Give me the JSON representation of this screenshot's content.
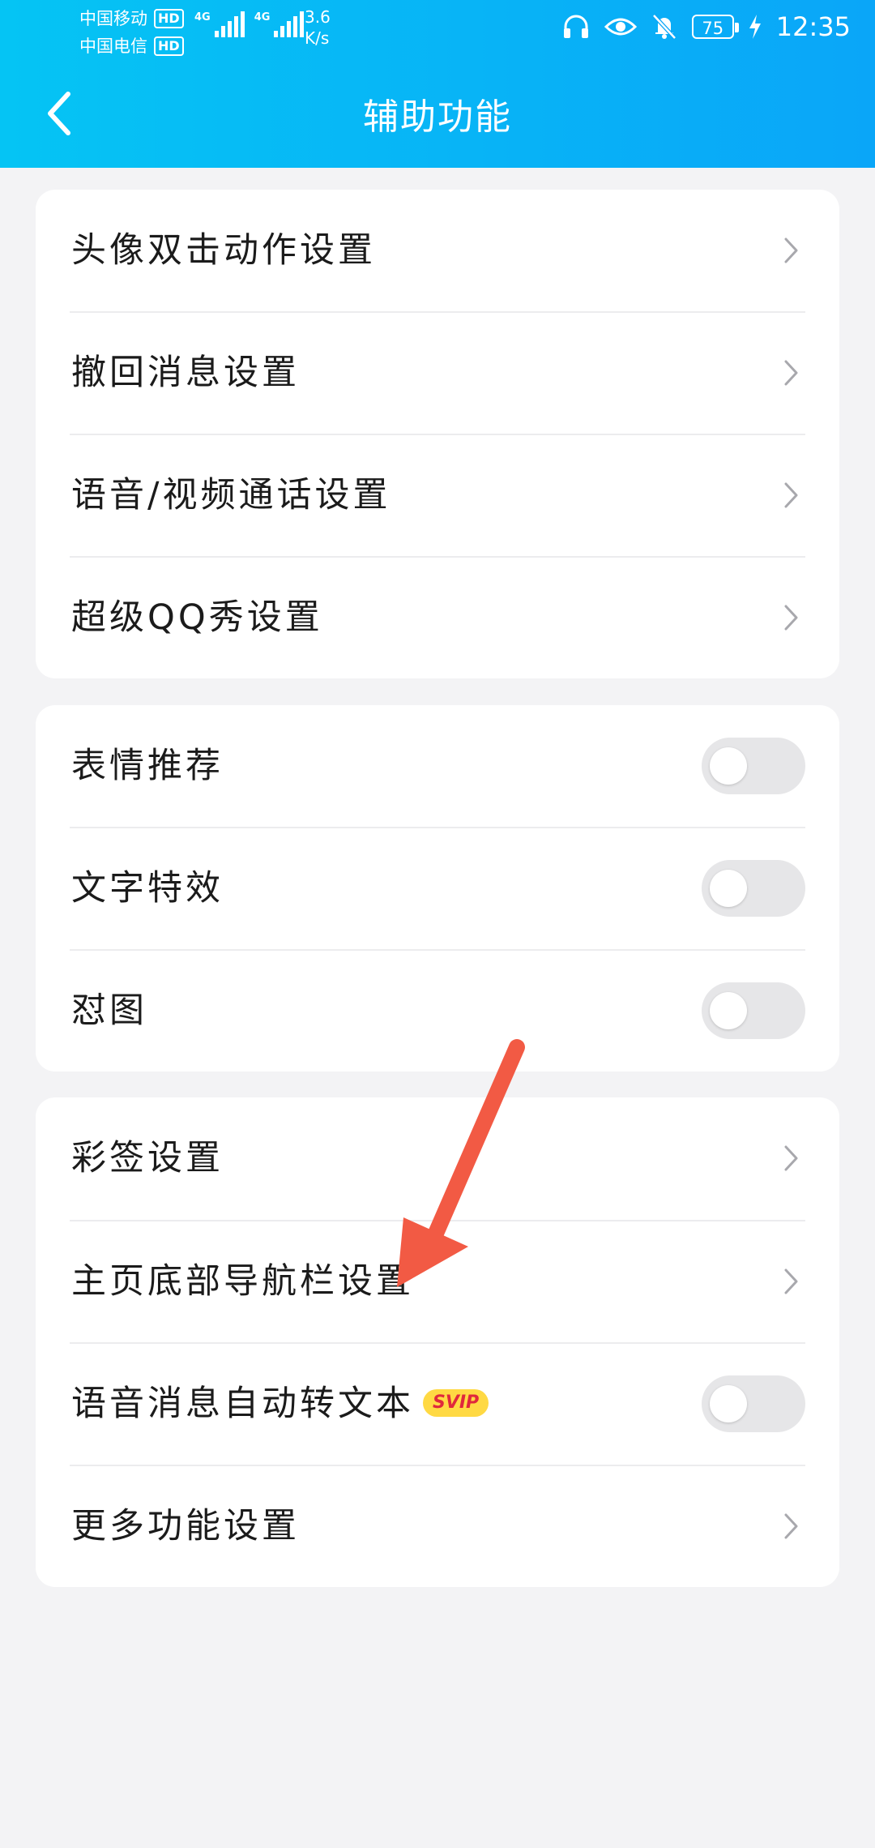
{
  "status_bar": {
    "carrier1": "中国移动",
    "carrier2": "中国电信",
    "hd": "HD",
    "net1": "4G",
    "net2": "4G",
    "speed_value": "3.6",
    "speed_unit": "K/s",
    "battery": "75",
    "time": "12:35"
  },
  "header": {
    "title": "辅助功能"
  },
  "groups": [
    {
      "items": [
        {
          "label": "头像双击动作设置",
          "type": "link"
        },
        {
          "label": "撤回消息设置",
          "type": "link"
        },
        {
          "label": "语音/视频通话设置",
          "type": "link"
        },
        {
          "label": "超级QQ秀设置",
          "type": "link"
        }
      ]
    },
    {
      "items": [
        {
          "label": "表情推荐",
          "type": "toggle",
          "on": false
        },
        {
          "label": "文字特效",
          "type": "toggle",
          "on": false
        },
        {
          "label": "怼图",
          "type": "toggle",
          "on": false
        }
      ]
    },
    {
      "items": [
        {
          "label": "彩签设置",
          "type": "link"
        },
        {
          "label": "主页底部导航栏设置",
          "type": "link"
        },
        {
          "label": "语音消息自动转文本",
          "type": "toggle",
          "on": false,
          "badge": "SVIP"
        },
        {
          "label": "更多功能设置",
          "type": "link"
        }
      ]
    }
  ],
  "colors": {
    "header_start": "#05c4f4",
    "header_end": "#0aa6f8",
    "background": "#f3f3f5",
    "annotation_arrow": "#f25a44",
    "svip_badge": "#ffd943"
  }
}
